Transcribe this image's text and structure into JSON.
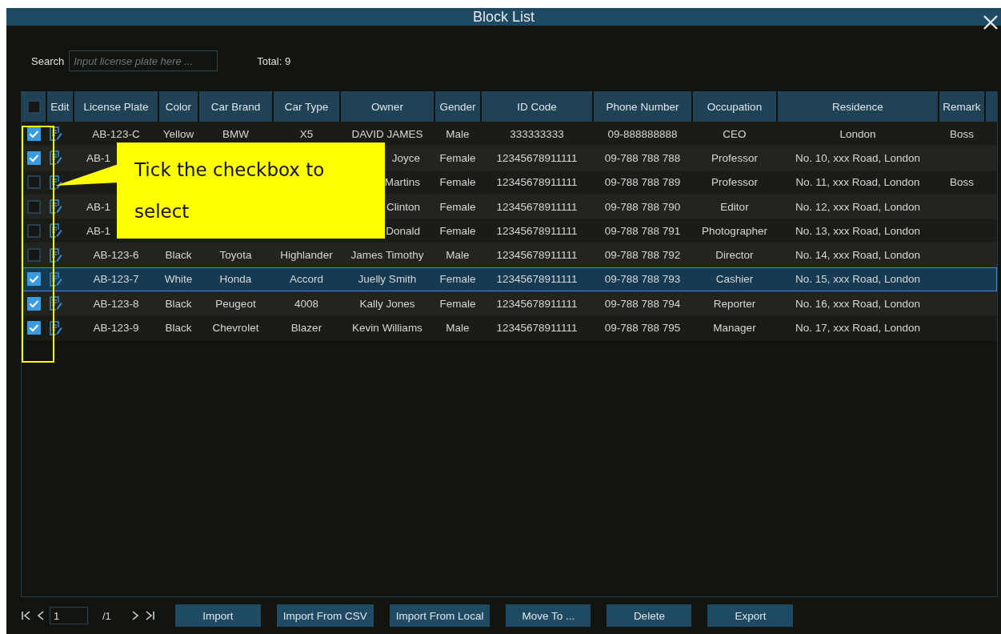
{
  "window": {
    "title": "Block List"
  },
  "search": {
    "label": "Search",
    "placeholder": "Input license plate here ...",
    "total": "Total: 9"
  },
  "table": {
    "select_all": {
      "checked": false
    },
    "columns": [
      "Edit",
      "License Plate",
      "Color",
      "Car Brand",
      "Car Type",
      "Owner",
      "Gender",
      "ID Code",
      "Phone Number",
      "Occupation",
      "Residence",
      "Remark"
    ],
    "rows": [
      {
        "checked": true,
        "selected": false,
        "cells": [
          "",
          "AB-123-C",
          "Yellow",
          "BMW",
          "X5",
          "DAVID JAMES",
          "Male",
          "333333333",
          "09-888888888",
          "CEO",
          "London",
          "Boss"
        ]
      },
      {
        "checked": true,
        "selected": false,
        "cells": [
          "",
          "AB-1",
          "",
          "",
          "",
          "Joyce",
          "Female",
          "12345678911111",
          "09-788 788 788",
          "Professor",
          "No. 10, xxx Road, London",
          ""
        ]
      },
      {
        "checked": false,
        "selected": false,
        "cells": [
          "",
          "",
          "",
          "",
          "",
          "Martins",
          "Female",
          "12345678911111",
          "09-788 788 789",
          "Professor",
          "No. 11, xxx Road, London",
          "Boss"
        ]
      },
      {
        "checked": false,
        "selected": false,
        "cells": [
          "",
          "AB-1",
          "",
          "",
          "",
          "Clinton",
          "Female",
          "12345678911111",
          "09-788 788 790",
          "Editor",
          "No. 12, xxx Road, London",
          ""
        ]
      },
      {
        "checked": false,
        "selected": false,
        "cells": [
          "",
          "AB-1",
          "",
          "",
          "",
          "Donald",
          "Female",
          "12345678911111",
          "09-788 788 791",
          "Photographer",
          "No. 13, xxx Road, London",
          ""
        ]
      },
      {
        "checked": false,
        "selected": false,
        "cells": [
          "",
          "AB-123-6",
          "Black",
          "Toyota",
          "Highlander",
          "James Timothy",
          "Male",
          "12345678911111",
          "09-788 788 792",
          "Director",
          "No. 14, xxx Road, London",
          ""
        ]
      },
      {
        "checked": true,
        "selected": true,
        "cells": [
          "",
          "AB-123-7",
          "White",
          "Honda",
          "Accord",
          "Juelly Smith",
          "Female",
          "12345678911111",
          "09-788 788 793",
          "Cashier",
          "No. 15, xxx Road, London",
          ""
        ]
      },
      {
        "checked": true,
        "selected": false,
        "cells": [
          "",
          "AB-123-8",
          "Black",
          "Peugeot",
          "4008",
          "Kally Jones",
          "Female",
          "12345678911111",
          "09-788 788 794",
          "Reporter",
          "No. 16, xxx Road, London",
          ""
        ]
      },
      {
        "checked": true,
        "selected": false,
        "cells": [
          "",
          "AB-123-9",
          "Black",
          "Chevrolet",
          "Blazer",
          "Kevin Williams",
          "Male",
          "12345678911111",
          "09-788 788 795",
          "Manager",
          "No. 17, xxx Road, London",
          ""
        ]
      }
    ]
  },
  "callout": {
    "text": "Tick the checkbox to select"
  },
  "pager": {
    "page": "1",
    "of": "/1"
  },
  "buttons": [
    "Import",
    "Import From CSV",
    "Import From Local",
    "Move To ...",
    "Delete",
    "Export"
  ]
}
